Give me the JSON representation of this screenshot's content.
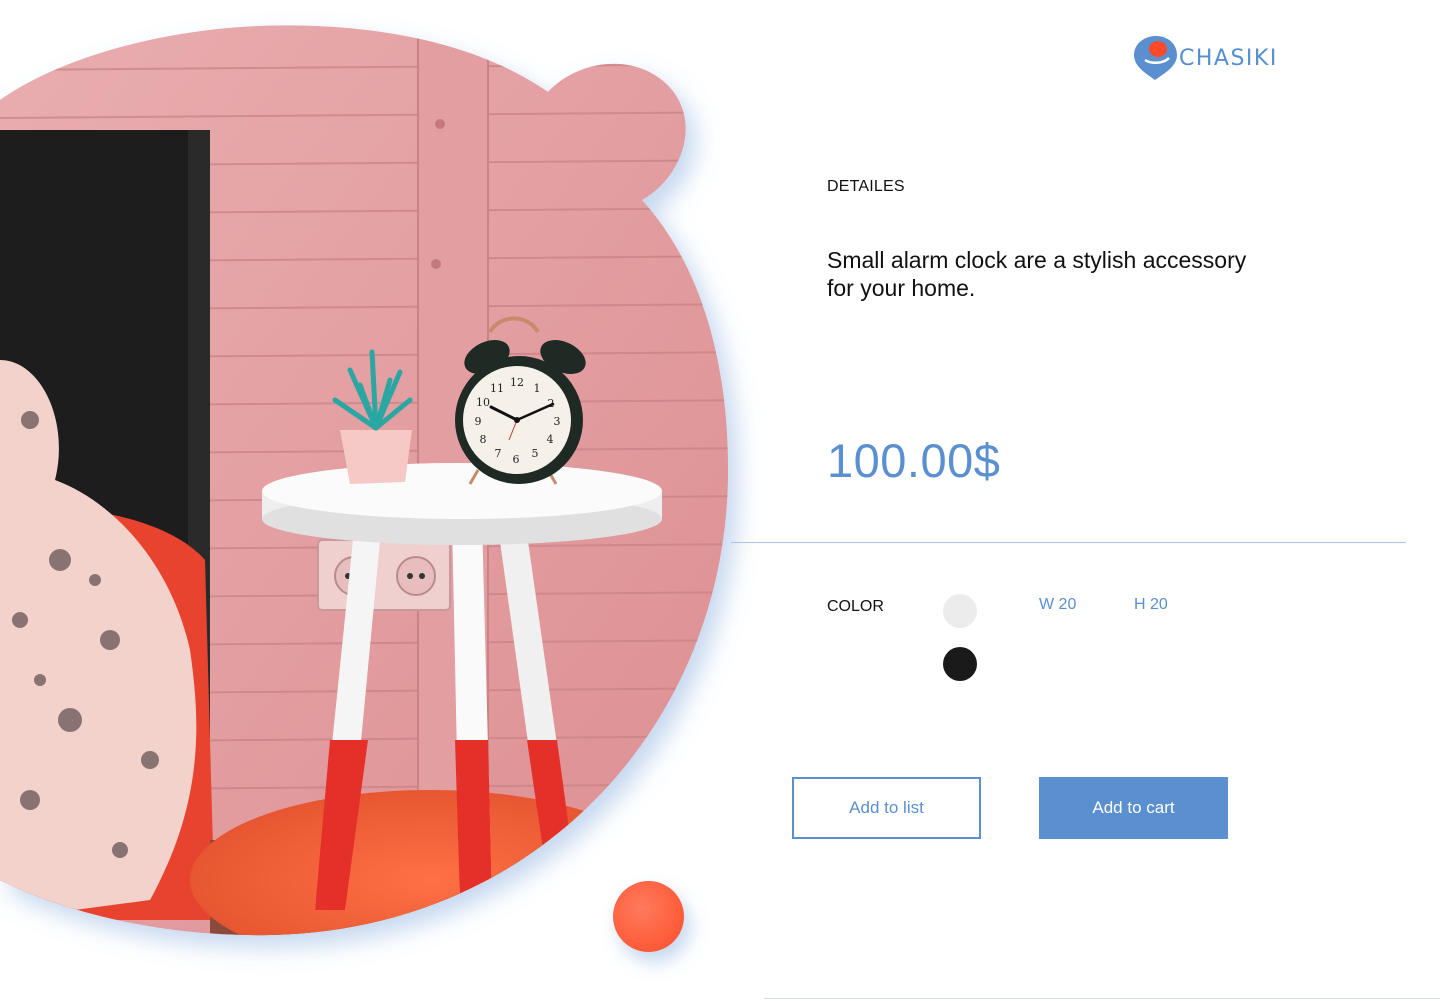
{
  "brand": {
    "name": "CHASIKI",
    "logo_icon": "pin-drop-icon",
    "accent_color": "#5a8fd0",
    "highlight_color": "#ff5a36"
  },
  "product": {
    "section_label": "DETAILES",
    "description": "Small alarm clock are a stylish accessory for your home.",
    "price": "100.00$"
  },
  "options": {
    "color_label": "COLOR",
    "colors": [
      {
        "name": "light-gray",
        "hex": "#ececec"
      },
      {
        "name": "black",
        "hex": "#1a1a1a"
      }
    ],
    "width": "W 20",
    "height": "H 20"
  },
  "actions": {
    "add_to_list": "Add to list",
    "add_to_cart": "Add to cart"
  }
}
